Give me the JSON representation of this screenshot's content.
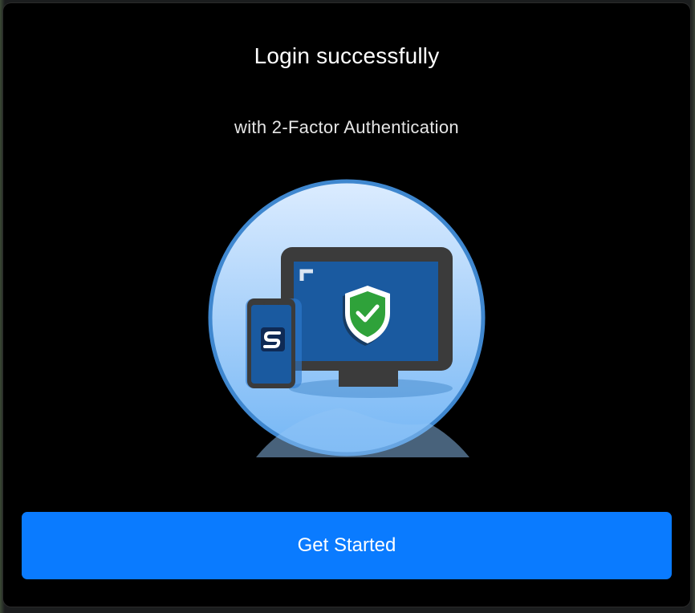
{
  "dialog": {
    "title": "Login successfully",
    "subtitle": "with 2-Factor Authentication",
    "button_label": "Get Started"
  },
  "illustration": {
    "icons": [
      "desktop-monitor-icon",
      "smartphone-icon",
      "shield-check-icon",
      "app-logo-icon"
    ]
  },
  "colors": {
    "accent": "#0a7bff",
    "background": "#000000",
    "shield_check": "#2fa23a",
    "circle_border": "#3f87cf"
  }
}
